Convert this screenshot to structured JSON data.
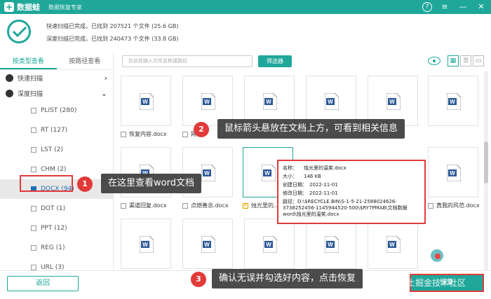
{
  "app": {
    "logo_letter": "+",
    "name": "数据蛙",
    "subtitle": "数据恢复专家",
    "window_buttons": {
      "help": "?",
      "menu": "≡",
      "minimize": "—",
      "close": "✕"
    }
  },
  "summary": {
    "quick_scan": "快速扫描已完成，已找到 207521 个文件 (25.6 GB)",
    "deep_scan": "深度扫描已完成，已找到 240473 个文件 (33.8 GB)"
  },
  "left": {
    "tabs": [
      {
        "label": "按类型查看"
      },
      {
        "label": "按路径查看"
      }
    ],
    "groups": {
      "quick": "快速扫描",
      "deep": "深度扫描",
      "quick_arrow": "›",
      "deep_arrow": "⌄"
    },
    "types": [
      {
        "label": "PLIST (280)"
      },
      {
        "label": "RT (127)"
      },
      {
        "label": "LST (2)"
      },
      {
        "label": "CHM (2)"
      },
      {
        "label": "DOCX (94)"
      },
      {
        "label": "DOT (1)"
      },
      {
        "label": "PPT (12)"
      },
      {
        "label": "REG (1)"
      },
      {
        "label": "URL (3)"
      }
    ]
  },
  "toolbar": {
    "search_placeholder": "在此处输入文件名称或路径",
    "filter_label": "筛选器",
    "view_icons": {
      "grid": "▦",
      "list": "☰",
      "detail": "▭"
    }
  },
  "files": [
    {
      "name": "恢复内容.docx"
    },
    {
      "name": "网..."
    },
    {
      "name": ""
    },
    {
      "name": ""
    },
    {
      "name": ""
    },
    {
      "name": "渠道回复.docx"
    },
    {
      "name": "点燃善念.docx"
    },
    {
      "name": "烛光里的..."
    },
    {
      "name": ""
    },
    {
      "name": "真我的风范.docx"
    }
  ],
  "info": {
    "name_k": "名称：",
    "name_v": "烛光里的温笑.docx",
    "size_k": "大小：",
    "size_v": "146 KB",
    "created_k": "创建日期：",
    "created_v": "2022-11-01",
    "modified_k": "修改日期：",
    "modified_v": "2022-11-01",
    "path_k": "路径：",
    "path_v": "D:\\$RECYCLE.BIN\\S-1-5-21-2588024626-3738252456-1145944520-500\\$RY7PMAB\\文档数据word\\烛光里的温笑.docx"
  },
  "annotations": [
    {
      "num": "1",
      "text": "在这里查看word文档"
    },
    {
      "num": "2",
      "text": "鼠标箭头悬放在文档上方，可看到相关信息"
    },
    {
      "num": "3",
      "text": "确认无误并勾选好内容，点击恢复"
    }
  ],
  "bottom": {
    "back_label": "返回",
    "recover_label": "恢复",
    "watermark": "稀土掘金技术社区"
  },
  "colors": {
    "accent": "#1fa79a",
    "highlight": "#e23a3a",
    "word_blue": "#2b5797"
  }
}
